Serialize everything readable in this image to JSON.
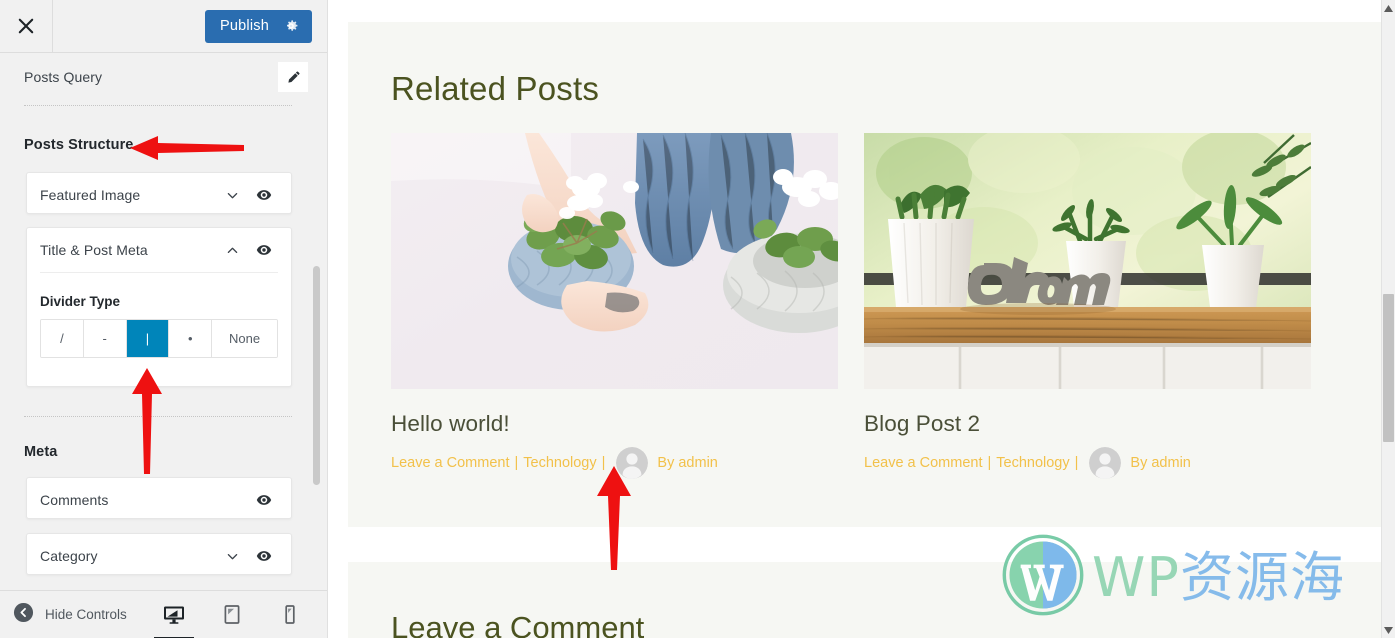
{
  "panel": {
    "close_icon": "close-icon",
    "publish_label": "Publish",
    "gear_icon": "gear-icon",
    "query_title": "Posts Query",
    "edit_icon": "pencil-icon",
    "sections": [
      {
        "heading": "Posts Structure"
      },
      {
        "heading": "Meta"
      }
    ],
    "structure_items": [
      {
        "label": "Featured Image",
        "chevron": "chevron-down",
        "eye": "eye-icon"
      },
      {
        "label": "Title & Post Meta",
        "chevron": "chevron-up",
        "eye": "eye-icon"
      }
    ],
    "divider_type": {
      "label": "Divider Type",
      "options": [
        "/",
        "-",
        "|",
        "•",
        "None"
      ],
      "selected_index": 2,
      "selected_color": "#0085ba"
    },
    "meta_items": [
      {
        "label": "Comments",
        "chevron": "",
        "eye": "eye-icon"
      },
      {
        "label": "Category",
        "chevron": "chevron-down",
        "eye": "eye-icon"
      }
    ],
    "footer": {
      "hide_controls_label": "Hide Controls",
      "back_icon": "chevron-left-circle-icon",
      "devices": [
        {
          "name": "desktop",
          "active": true
        },
        {
          "name": "tablet",
          "active": false
        },
        {
          "name": "mobile",
          "active": false
        }
      ]
    }
  },
  "preview": {
    "related_heading": "Related Posts",
    "heading_color": "#4b5320",
    "meta_color": "#f2c14a",
    "posts": [
      {
        "title": "Hello world!",
        "image_alt": "hands-potting-violet-plant-in-knitted-basket",
        "meta": {
          "comment_link": "Leave a Comment",
          "divider": "|",
          "category": "Technology",
          "author": "By admin",
          "avatar": "avatar-placeholder-icon"
        }
      },
      {
        "title": "Blog Post 2",
        "image_alt": "succulents-and-dream-sign-on-windowsill",
        "meta": {
          "comment_link": "Leave a Comment",
          "divider": "|",
          "category": "Technology",
          "author": "By admin",
          "avatar": "avatar-placeholder-icon"
        }
      }
    ],
    "comment_heading": "Leave a Comment"
  },
  "watermark": {
    "latin": "WP",
    "chinese": "资源海",
    "logo": "wordpress-logo-icon"
  },
  "annotations": {
    "arrows": [
      {
        "name": "arrow-posts-structure",
        "direction": "left"
      },
      {
        "name": "arrow-divider-type",
        "direction": "up"
      },
      {
        "name": "arrow-post-meta",
        "direction": "up"
      }
    ],
    "color": "#ee1111"
  },
  "browser_scrollbar": {
    "up_arrow": "scroll-up-arrow-icon",
    "down_arrow": "scroll-down-arrow-icon"
  }
}
